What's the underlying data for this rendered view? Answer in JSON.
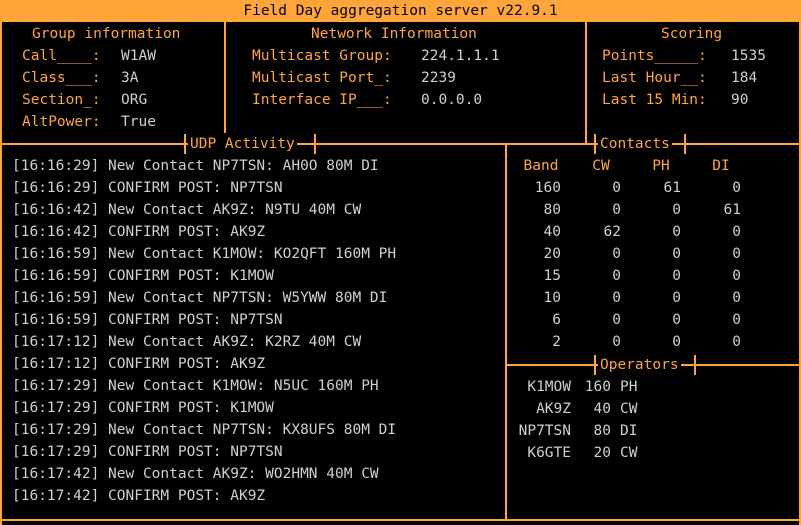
{
  "window": {
    "title": "Field Day aggregation server v22.9.1"
  },
  "group": {
    "title": "Group information",
    "rows": [
      {
        "label": "Call____:",
        "value": "W1AW"
      },
      {
        "label": "Class___:",
        "value": "3A"
      },
      {
        "label": "Section_:",
        "value": "ORG"
      },
      {
        "label": "AltPower:",
        "value": "True"
      }
    ]
  },
  "network": {
    "title": "Network Information",
    "rows": [
      {
        "label": "Multicast Group:",
        "value": "224.1.1.1"
      },
      {
        "label": "Multicast Port_:",
        "value": "2239"
      },
      {
        "label": "Interface IP___:",
        "value": "0.0.0.0"
      }
    ]
  },
  "scoring": {
    "title": "Scoring",
    "rows": [
      {
        "label": "Points_____:",
        "value": "1535"
      },
      {
        "label": "Last Hour__:",
        "value": "184"
      },
      {
        "label": "Last 15 Min:",
        "value": "90"
      }
    ]
  },
  "udp": {
    "title": "UDP Activity",
    "lines": [
      "[16:16:29] New Contact NP7TSN: AH0O 80M DI",
      "[16:16:29] CONFIRM POST: NP7TSN",
      "[16:16:42] New Contact AK9Z: N9TU 40M CW",
      "[16:16:42] CONFIRM POST: AK9Z",
      "[16:16:59] New Contact K1MOW: KO2QFT 160M PH",
      "[16:16:59] CONFIRM POST: K1MOW",
      "[16:16:59] New Contact NP7TSN: W5YWW 80M DI",
      "[16:16:59] CONFIRM POST: NP7TSN",
      "[16:17:12] New Contact AK9Z: K2RZ 40M CW",
      "[16:17:12] CONFIRM POST: AK9Z",
      "[16:17:29] New Contact K1MOW: N5UC 160M PH",
      "[16:17:29] CONFIRM POST: K1MOW",
      "[16:17:29] New Contact NP7TSN: KX8UFS 80M DI",
      "[16:17:29] CONFIRM POST: NP7TSN",
      "[16:17:42] New Contact AK9Z: WO2HMN 40M CW",
      "[16:17:42] CONFIRM POST: AK9Z"
    ]
  },
  "contacts": {
    "title": "Contacts",
    "headers": [
      "Band",
      "CW",
      "PH",
      "DI"
    ],
    "rows": [
      [
        "160",
        "0",
        "61",
        "0"
      ],
      [
        "80",
        "0",
        "0",
        "61"
      ],
      [
        "40",
        "62",
        "0",
        "0"
      ],
      [
        "20",
        "0",
        "0",
        "0"
      ],
      [
        "15",
        "0",
        "0",
        "0"
      ],
      [
        "10",
        "0",
        "0",
        "0"
      ],
      [
        "6",
        "0",
        "0",
        "0"
      ],
      [
        "2",
        "0",
        "0",
        "0"
      ]
    ]
  },
  "operators": {
    "title": "Operators",
    "rows": [
      {
        "call": "K1MOW",
        "band": "160",
        "mode": "PH"
      },
      {
        "call": "AK9Z",
        "band": "40",
        "mode": "CW"
      },
      {
        "call": "NP7TSN",
        "band": "80",
        "mode": "DI"
      },
      {
        "call": "K6GTE",
        "band": "20",
        "mode": "CW"
      }
    ]
  }
}
